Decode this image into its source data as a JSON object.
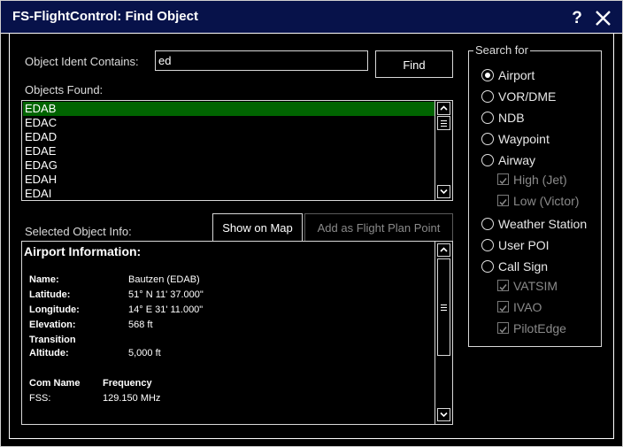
{
  "window": {
    "title": "FS-FlightControl: Find Object",
    "help_glyph": "?"
  },
  "search": {
    "label": "Object Ident Contains:",
    "value": "ed",
    "find_label": "Find"
  },
  "objects": {
    "label": "Objects Found:",
    "items": [
      "EDAB",
      "EDAC",
      "EDAD",
      "EDAE",
      "EDAG",
      "EDAH",
      "EDAI"
    ],
    "selected_index": 0
  },
  "selected_info": {
    "label": "Selected Object Info:",
    "show_on_map_label": "Show on Map",
    "add_flight_plan_label": "Add as Flight Plan Point",
    "heading": "Airport Information:",
    "name_key": "Name:",
    "name_val": "Bautzen (EDAB)",
    "lat_key": "Latitude:",
    "lat_val": "51° N 11' 37.000\"",
    "lon_key": "Longitude:",
    "lon_val": "14° E 31' 11.000\"",
    "elev_key": "Elevation:",
    "elev_val": "568 ft",
    "trans_key1": "Transition",
    "trans_key2": "Altitude:",
    "trans_val": "5,000 ft",
    "com_name_header": "Com Name",
    "frequency_header": "Frequency",
    "com_name": "FSS:",
    "com_freq": "129.150 MHz"
  },
  "search_for": {
    "legend": "Search for",
    "airport": "Airport",
    "vordme": "VOR/DME",
    "ndb": "NDB",
    "waypoint": "Waypoint",
    "airway": "Airway",
    "airway_high": "High (Jet)",
    "airway_low": "Low (Victor)",
    "weather_station": "Weather Station",
    "user_poi": "User POI",
    "call_sign": "Call Sign",
    "vatsim": "VATSIM",
    "ivao": "IVAO",
    "pilotedge": "PilotEdge",
    "selected": "Airport"
  },
  "colors": {
    "titlebar": "#07124a",
    "selection": "#006400"
  }
}
